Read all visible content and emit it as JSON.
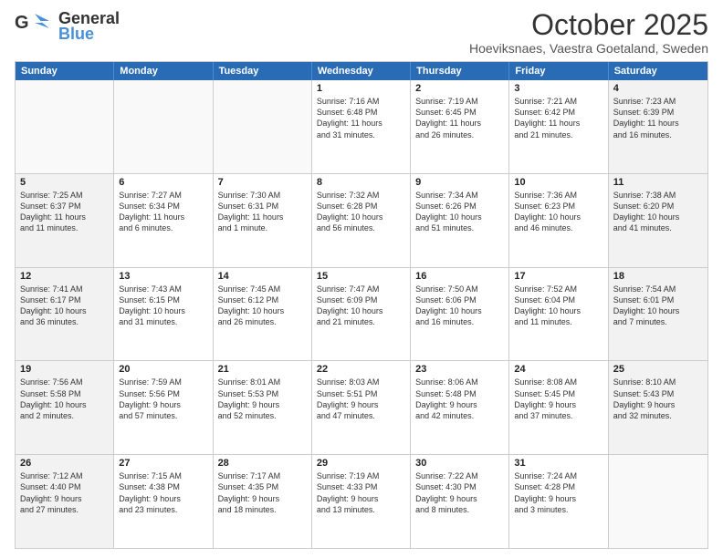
{
  "header": {
    "logo_general": "General",
    "logo_blue": "Blue",
    "month": "October 2025",
    "location": "Hoeviksnaes, Vaestra Goetaland, Sweden"
  },
  "days_of_week": [
    "Sunday",
    "Monday",
    "Tuesday",
    "Wednesday",
    "Thursday",
    "Friday",
    "Saturday"
  ],
  "weeks": [
    [
      {
        "day": "",
        "text": "",
        "empty": true
      },
      {
        "day": "",
        "text": "",
        "empty": true
      },
      {
        "day": "",
        "text": "",
        "empty": true
      },
      {
        "day": "1",
        "text": "Sunrise: 7:16 AM\nSunset: 6:48 PM\nDaylight: 11 hours\nand 31 minutes.",
        "empty": false
      },
      {
        "day": "2",
        "text": "Sunrise: 7:19 AM\nSunset: 6:45 PM\nDaylight: 11 hours\nand 26 minutes.",
        "empty": false
      },
      {
        "day": "3",
        "text": "Sunrise: 7:21 AM\nSunset: 6:42 PM\nDaylight: 11 hours\nand 21 minutes.",
        "empty": false
      },
      {
        "day": "4",
        "text": "Sunrise: 7:23 AM\nSunset: 6:39 PM\nDaylight: 11 hours\nand 16 minutes.",
        "empty": false
      }
    ],
    [
      {
        "day": "5",
        "text": "Sunrise: 7:25 AM\nSunset: 6:37 PM\nDaylight: 11 hours\nand 11 minutes.",
        "empty": false
      },
      {
        "day": "6",
        "text": "Sunrise: 7:27 AM\nSunset: 6:34 PM\nDaylight: 11 hours\nand 6 minutes.",
        "empty": false
      },
      {
        "day": "7",
        "text": "Sunrise: 7:30 AM\nSunset: 6:31 PM\nDaylight: 11 hours\nand 1 minute.",
        "empty": false
      },
      {
        "day": "8",
        "text": "Sunrise: 7:32 AM\nSunset: 6:28 PM\nDaylight: 10 hours\nand 56 minutes.",
        "empty": false
      },
      {
        "day": "9",
        "text": "Sunrise: 7:34 AM\nSunset: 6:26 PM\nDaylight: 10 hours\nand 51 minutes.",
        "empty": false
      },
      {
        "day": "10",
        "text": "Sunrise: 7:36 AM\nSunset: 6:23 PM\nDaylight: 10 hours\nand 46 minutes.",
        "empty": false
      },
      {
        "day": "11",
        "text": "Sunrise: 7:38 AM\nSunset: 6:20 PM\nDaylight: 10 hours\nand 41 minutes.",
        "empty": false
      }
    ],
    [
      {
        "day": "12",
        "text": "Sunrise: 7:41 AM\nSunset: 6:17 PM\nDaylight: 10 hours\nand 36 minutes.",
        "empty": false
      },
      {
        "day": "13",
        "text": "Sunrise: 7:43 AM\nSunset: 6:15 PM\nDaylight: 10 hours\nand 31 minutes.",
        "empty": false
      },
      {
        "day": "14",
        "text": "Sunrise: 7:45 AM\nSunset: 6:12 PM\nDaylight: 10 hours\nand 26 minutes.",
        "empty": false
      },
      {
        "day": "15",
        "text": "Sunrise: 7:47 AM\nSunset: 6:09 PM\nDaylight: 10 hours\nand 21 minutes.",
        "empty": false
      },
      {
        "day": "16",
        "text": "Sunrise: 7:50 AM\nSunset: 6:06 PM\nDaylight: 10 hours\nand 16 minutes.",
        "empty": false
      },
      {
        "day": "17",
        "text": "Sunrise: 7:52 AM\nSunset: 6:04 PM\nDaylight: 10 hours\nand 11 minutes.",
        "empty": false
      },
      {
        "day": "18",
        "text": "Sunrise: 7:54 AM\nSunset: 6:01 PM\nDaylight: 10 hours\nand 7 minutes.",
        "empty": false
      }
    ],
    [
      {
        "day": "19",
        "text": "Sunrise: 7:56 AM\nSunset: 5:58 PM\nDaylight: 10 hours\nand 2 minutes.",
        "empty": false
      },
      {
        "day": "20",
        "text": "Sunrise: 7:59 AM\nSunset: 5:56 PM\nDaylight: 9 hours\nand 57 minutes.",
        "empty": false
      },
      {
        "day": "21",
        "text": "Sunrise: 8:01 AM\nSunset: 5:53 PM\nDaylight: 9 hours\nand 52 minutes.",
        "empty": false
      },
      {
        "day": "22",
        "text": "Sunrise: 8:03 AM\nSunset: 5:51 PM\nDaylight: 9 hours\nand 47 minutes.",
        "empty": false
      },
      {
        "day": "23",
        "text": "Sunrise: 8:06 AM\nSunset: 5:48 PM\nDaylight: 9 hours\nand 42 minutes.",
        "empty": false
      },
      {
        "day": "24",
        "text": "Sunrise: 8:08 AM\nSunset: 5:45 PM\nDaylight: 9 hours\nand 37 minutes.",
        "empty": false
      },
      {
        "day": "25",
        "text": "Sunrise: 8:10 AM\nSunset: 5:43 PM\nDaylight: 9 hours\nand 32 minutes.",
        "empty": false
      }
    ],
    [
      {
        "day": "26",
        "text": "Sunrise: 7:12 AM\nSunset: 4:40 PM\nDaylight: 9 hours\nand 27 minutes.",
        "empty": false
      },
      {
        "day": "27",
        "text": "Sunrise: 7:15 AM\nSunset: 4:38 PM\nDaylight: 9 hours\nand 23 minutes.",
        "empty": false
      },
      {
        "day": "28",
        "text": "Sunrise: 7:17 AM\nSunset: 4:35 PM\nDaylight: 9 hours\nand 18 minutes.",
        "empty": false
      },
      {
        "day": "29",
        "text": "Sunrise: 7:19 AM\nSunset: 4:33 PM\nDaylight: 9 hours\nand 13 minutes.",
        "empty": false
      },
      {
        "day": "30",
        "text": "Sunrise: 7:22 AM\nSunset: 4:30 PM\nDaylight: 9 hours\nand 8 minutes.",
        "empty": false
      },
      {
        "day": "31",
        "text": "Sunrise: 7:24 AM\nSunset: 4:28 PM\nDaylight: 9 hours\nand 3 minutes.",
        "empty": false
      },
      {
        "day": "",
        "text": "",
        "empty": true
      }
    ]
  ]
}
